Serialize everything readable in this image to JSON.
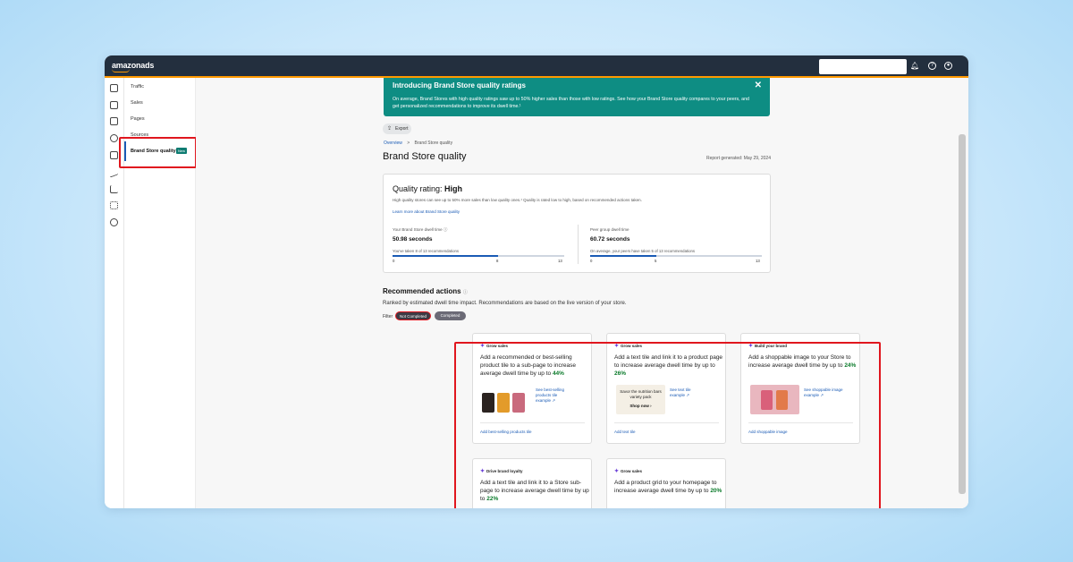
{
  "app": {
    "logo": "amazonads"
  },
  "subnav": {
    "items": [
      "Traffic",
      "Sales",
      "Pages",
      "Sources"
    ],
    "active": {
      "label": "Brand Store quality",
      "badge": "New"
    }
  },
  "banner": {
    "title": "Introducing Brand Store quality ratings",
    "body": "On average, Brand Stores with high quality ratings saw up to 50% higher sales than those with low ratings. See how your Brand Store quality compares to your peers, and get personalized recommendations to improve its dwell time.¹",
    "close": "✕"
  },
  "export_label": "Export",
  "breadcrumb": {
    "root": "Overview",
    "sep": ">",
    "current": "Brand Store quality"
  },
  "page_title": "Brand Store quality",
  "report_generated": "Report generated: May 29, 2024",
  "quality": {
    "title_prefix": "Quality rating: ",
    "rating": "High",
    "subtitle": "High quality stores can see up to 50% more sales than low quality ones.¹ Quality is rated low to high, based on recommended actions taken.",
    "learn_more": "Learn more about Brand Store quality",
    "yours": {
      "label": "Your Brand Store dwell time ⓘ",
      "value": "50.98 seconds",
      "note": "You've taken 8 of 13 recommendations",
      "progress": 0.615,
      "ticks": [
        "0",
        "8",
        "13"
      ]
    },
    "peers": {
      "label": "Peer group dwell time",
      "value": "60.72 seconds",
      "note": "On average, your peers have taken 5 of 13 recommendations",
      "progress": 0.385,
      "ticks": [
        "0",
        "5",
        "13"
      ]
    }
  },
  "recommended": {
    "title": "Recommended actions",
    "subtitle": "Ranked by estimated dwell time impact. Recommendations are based on the live version of your store.",
    "filter_label": "Filter",
    "filters": [
      "Not Completed",
      "Completed"
    ]
  },
  "cards": [
    {
      "tag": "Grow sales",
      "text": "Add a recommended or best-selling product tile to a sub-page to increase average dwell time by up to ",
      "pct": "44%",
      "example": "See best-selling products tile example",
      "action": "Add best-selling products tile"
    },
    {
      "tag": "Grow sales",
      "text": "Add a text tile and link it to a product page to increase average dwell time by up to ",
      "pct": "26%",
      "example": "See text tile example",
      "action": "Add text tile",
      "tile_text": "Savor the nutrition bars variety pack",
      "tile_cta": "Shop now ›"
    },
    {
      "tag": "Build your brand",
      "text": "Add a shoppable image to your Store to increase average dwell time by up to ",
      "pct": "24%",
      "example": "See shoppable image example",
      "action": "Add shoppable image"
    },
    {
      "tag": "Drive brand loyalty",
      "text": "Add a text tile and link it to a Store sub-page to increase average dwell time by up to ",
      "pct": "22%"
    },
    {
      "tag": "Grow sales",
      "text": "Add a product grid to your homepage to increase average dwell time by up to ",
      "pct": "20%"
    }
  ],
  "colors": {
    "accent": "#0e8d83",
    "link": "#1a5bb5",
    "highlight": "#e0161e",
    "nav": "#232f3e"
  }
}
